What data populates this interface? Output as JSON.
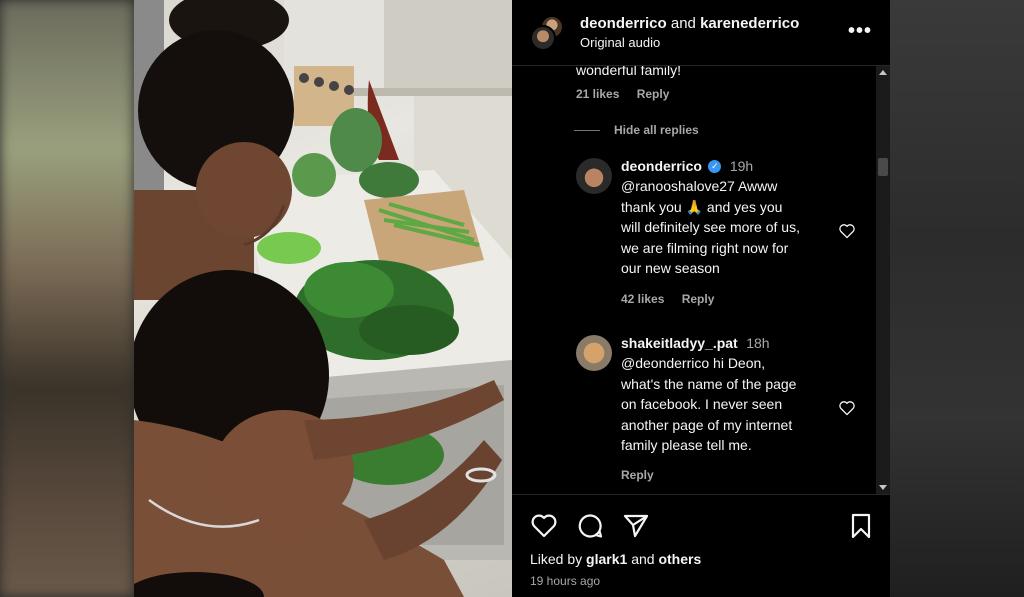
{
  "header": {
    "user1": "deonderrico",
    "conjunction": "and",
    "user2": "karenederrico",
    "audio": "Original audio"
  },
  "thread": {
    "cut_text": "wonderful family!",
    "parent_likes": "21 likes",
    "parent_reply": "Reply",
    "hide_replies": "Hide all replies"
  },
  "replies": [
    {
      "user": "deonderrico",
      "time": "19h",
      "verified": true,
      "lines": [
        "@ranooshalove27 Awww",
        "thank you 🙏 and yes you",
        "will definitely see more of us,",
        "we are filming right now for",
        "our new season"
      ],
      "likes": "42 likes",
      "reply": "Reply"
    },
    {
      "user": "shakeitladyy_.pat",
      "time": "18h",
      "verified": false,
      "lines": [
        "@deonderrico hi Deon,",
        "what's the name of the page",
        "on facebook. I never seen",
        "another page of my internet",
        "family please tell me."
      ],
      "reply": "Reply"
    }
  ],
  "footer": {
    "liked_prefix": "Liked by",
    "liked_user": "glark1",
    "liked_and": "and",
    "liked_others": "others",
    "timestamp": "19 hours ago"
  },
  "icons": {
    "more": "more-options-icon",
    "like": "heart-icon",
    "comment": "comment-icon",
    "share": "send-icon",
    "save": "bookmark-icon"
  },
  "colors": {
    "background": "#000000",
    "text": "#f5f5f5",
    "muted": "#a8a8a8",
    "verified": "#3897f0"
  }
}
